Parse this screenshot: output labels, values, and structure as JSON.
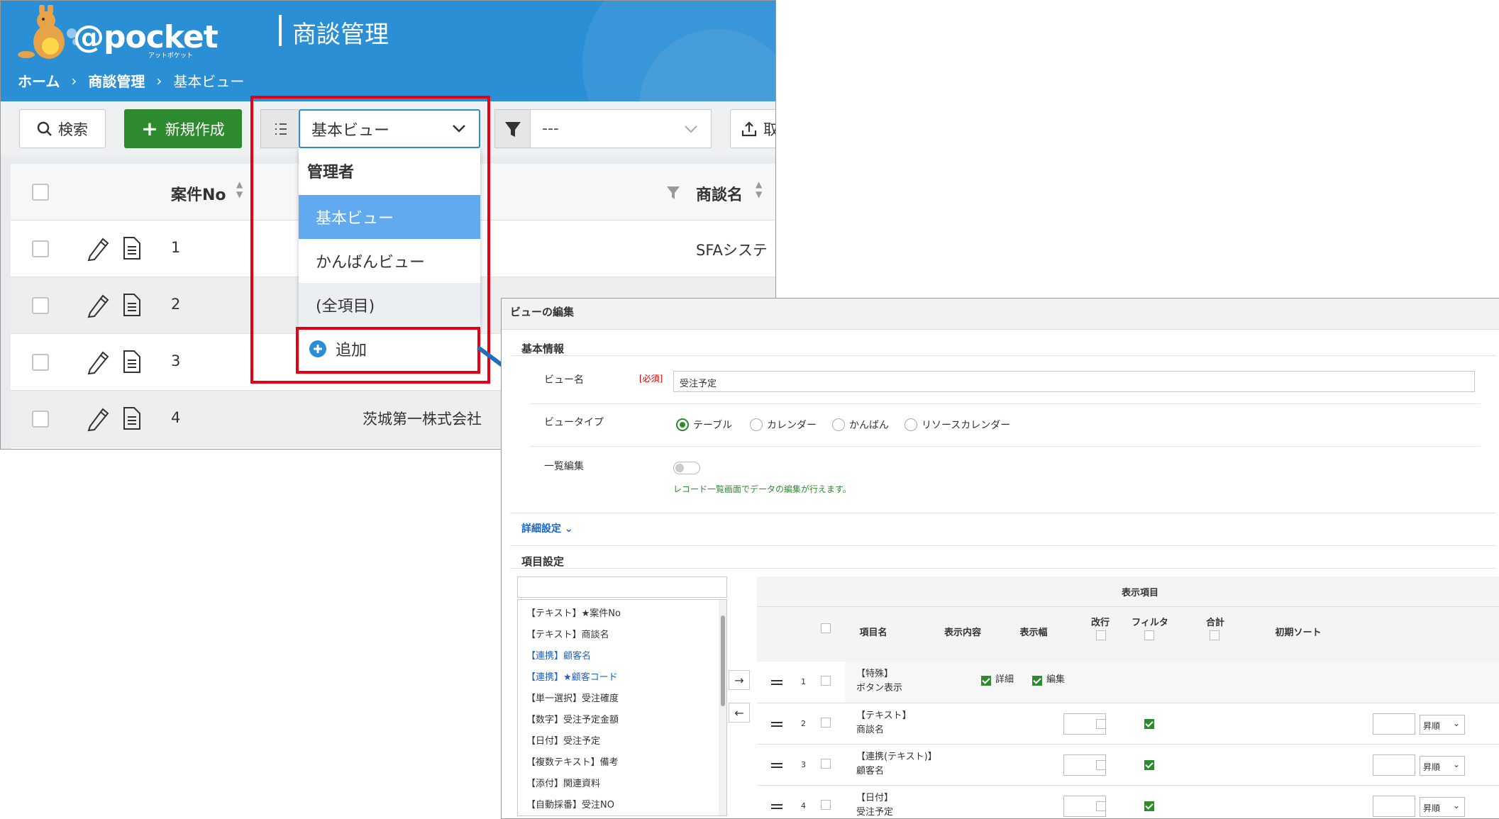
{
  "app": {
    "logo": "@pocket",
    "logo_sub": "アットポケット",
    "title": "商談管理",
    "breadcrumb": [
      "ホーム",
      "商談管理",
      "基本ビュー"
    ],
    "toolbar": {
      "search_label": "検索",
      "new_label": "新規作成",
      "view_selected": "基本ビュー",
      "filter_selected": "---",
      "export_label": "取"
    },
    "grid": {
      "col_case_no": "案件No",
      "col_name": "商談名",
      "rows": [
        {
          "no": "1",
          "company": "",
          "name": "SFAシステ"
        },
        {
          "no": "2",
          "company": "",
          "name": ""
        },
        {
          "no": "3",
          "company": "",
          "name": ""
        },
        {
          "no": "4",
          "company": "茨城第一株式会社",
          "name": ""
        }
      ]
    },
    "dropdown": {
      "group_label": "管理者",
      "items": [
        "基本ビュー",
        "かんばんビュー",
        "(全項目)"
      ],
      "add_label": "追加"
    }
  },
  "panel": {
    "title": "ビューの編集",
    "basic_section": "基本情報",
    "view_name_label": "ビュー名",
    "required": "[必須]",
    "view_name_value": "受注予定",
    "view_type_label": "ビュータイプ",
    "view_types": [
      "テーブル",
      "カレンダー",
      "かんばん",
      "リソースカレンダー"
    ],
    "bulk_edit_label": "一覧編集",
    "bulk_edit_hint": "レコード一覧画面でデータの編集が行えます。",
    "detail_link": "詳細設定",
    "item_section": "項目設定",
    "field_list": [
      {
        "text": "【テキスト】★案件No",
        "linked": false
      },
      {
        "text": "【テキスト】商談名",
        "linked": false
      },
      {
        "text": "【連携】顧客名",
        "linked": true
      },
      {
        "text": "【連携】★顧客コード",
        "linked": true
      },
      {
        "text": "【単一選択】受注確度",
        "linked": false
      },
      {
        "text": "【数字】受注予定金額",
        "linked": false
      },
      {
        "text": "【日付】受注予定",
        "linked": false
      },
      {
        "text": "【複数テキスト】備考",
        "linked": false
      },
      {
        "text": "【添付】関連資料",
        "linked": false
      },
      {
        "text": "【自動採番】受注NO",
        "linked": false
      }
    ],
    "table": {
      "group_header": "表示項目",
      "headers": {
        "item_name": "項目名",
        "display": "表示内容",
        "width": "表示幅",
        "line_break": "改行",
        "filter": "フィルタ",
        "total": "合計",
        "sort": "初期ソート"
      },
      "rows": [
        {
          "num": "1",
          "type": "【特殊】",
          "name": "ボタン表示",
          "detail": "詳細",
          "edit": "編集"
        },
        {
          "num": "2",
          "type": "【テキスト】",
          "name": "商談名",
          "sort": "昇順"
        },
        {
          "num": "3",
          "type": "【連携(テキスト)】",
          "name": "顧客名",
          "sort": "昇順"
        },
        {
          "num": "4",
          "type": "【日付】",
          "name": "受注予定",
          "sort": "昇順"
        }
      ]
    }
  },
  "colors": {
    "header_blue": "#2b8fd6",
    "accent_green": "#2e8a2e",
    "highlight_red": "#e60012",
    "selected_item": "#62aaf0"
  }
}
